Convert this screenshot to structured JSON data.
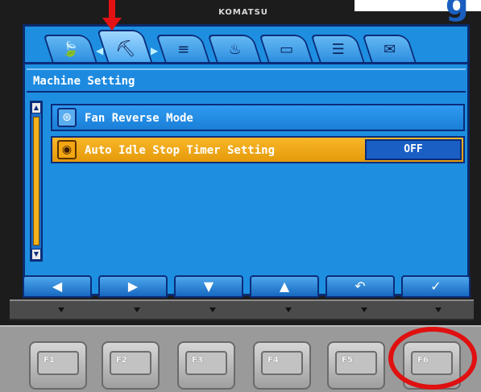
{
  "brand": "KOMATSU",
  "corner_glyph": "g",
  "tabs": [
    {
      "icon": "leaf-icon",
      "glyph": "🍃",
      "active": false
    },
    {
      "icon": "machine-operator-icon",
      "glyph": "⛏",
      "active": true
    },
    {
      "icon": "airflow-icon",
      "glyph": "≡",
      "active": false
    },
    {
      "icon": "fluid-level-icon",
      "glyph": "♨",
      "active": false
    },
    {
      "icon": "manual-book-icon",
      "glyph": "▭",
      "active": false
    },
    {
      "icon": "list-icon",
      "glyph": "☰",
      "active": false
    },
    {
      "icon": "mail-icon",
      "glyph": "✉",
      "active": false
    }
  ],
  "screen": {
    "title": "Machine Setting",
    "items": [
      {
        "icon": "fan-icon",
        "glyph": "⊛",
        "label": "Fan Reverse Mode",
        "value": "",
        "selected": false
      },
      {
        "icon": "auto-idle-icon",
        "glyph": "◉",
        "label": "Auto Idle Stop Timer Setting",
        "value": "OFF",
        "selected": true
      }
    ]
  },
  "softkeys": [
    {
      "name": "left",
      "glyph": "◀"
    },
    {
      "name": "right",
      "glyph": "▶"
    },
    {
      "name": "down",
      "glyph": "▼"
    },
    {
      "name": "up",
      "glyph": "▲"
    },
    {
      "name": "back",
      "glyph": "↶"
    },
    {
      "name": "confirm",
      "glyph": "✓"
    }
  ],
  "function_keys": [
    "F1",
    "F2",
    "F3",
    "F4",
    "F5",
    "F6"
  ],
  "colors": {
    "screen_bg": "#1e8fe0",
    "selected_row": "#f4a612",
    "callout": "#e41212"
  }
}
